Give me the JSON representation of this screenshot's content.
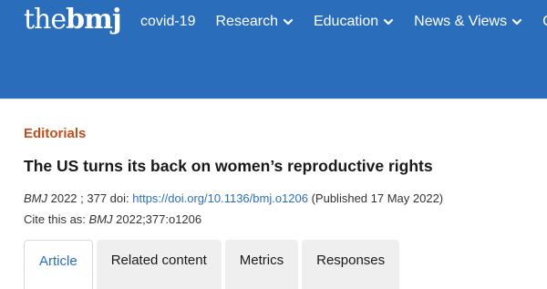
{
  "header": {
    "logo_the": "the",
    "logo_bmj": "bmj",
    "bg_color": "#2a6ebb",
    "nav": [
      {
        "label": "covid-19",
        "has_dropdown": false
      },
      {
        "label": "Research",
        "has_dropdown": true
      },
      {
        "label": "Education",
        "has_dropdown": true
      },
      {
        "label": "News & Views",
        "has_dropdown": true
      },
      {
        "label": "Ca",
        "has_dropdown": false
      }
    ]
  },
  "article": {
    "section": "Editorials",
    "section_color": "#c14e1c",
    "title": "The US turns its back on women’s reproductive rights",
    "meta": {
      "journal": "BMJ",
      "year_vol": " 2022 ; 377  doi: ",
      "doi_link": "https://doi.org/10.1136/bmj.o1206",
      "published": " (Published 17 May 2022)"
    },
    "cite": {
      "prefix": "Cite this as: ",
      "journal": "BMJ",
      "ref": " 2022;377:o1206"
    }
  },
  "tabs": [
    {
      "label": "Article",
      "active": true
    },
    {
      "label": "Related content",
      "active": false
    },
    {
      "label": "Metrics",
      "active": false
    },
    {
      "label": "Responses",
      "active": false
    }
  ],
  "icons": {
    "chevron": "chevron-down-icon"
  },
  "colors": {
    "link": "#2a6ebb"
  }
}
